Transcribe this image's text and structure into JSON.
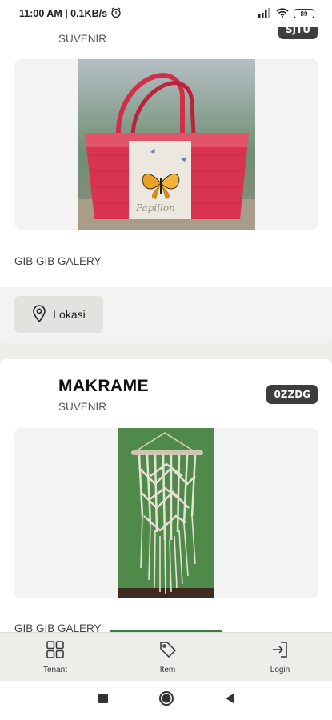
{
  "status_bar": {
    "time_speed": "11:00 AM | 0.1KB/s",
    "alarm_icon": "alarm-clock-icon",
    "signal_icon": "cell-signal-icon",
    "wifi_icon": "wifi-icon",
    "battery": "89"
  },
  "cards": [
    {
      "title": "",
      "category": "SUVENIR",
      "code": "SJTU",
      "tenant": "GIB GIB GALERY",
      "location_label": "Lokasi",
      "image_desc": "red woven handbag with butterfly print"
    },
    {
      "title": "MAKRAME",
      "category": "SUVENIR",
      "code": "0ZZDG",
      "tenant": "GIB GIB GALERY",
      "image_desc": "macrame wall hanging on green background"
    }
  ],
  "bottom_nav": {
    "items": [
      {
        "label": "Tenant",
        "icon": "grid-icon"
      },
      {
        "label": "Item",
        "icon": "tag-icon"
      },
      {
        "label": "Login",
        "icon": "login-icon"
      }
    ]
  },
  "colors": {
    "badge": "#3d3d3d",
    "accent_line": "#3a7d3a",
    "bag_red": "#d8344f",
    "macrame_bg": "#4f8a4a"
  }
}
